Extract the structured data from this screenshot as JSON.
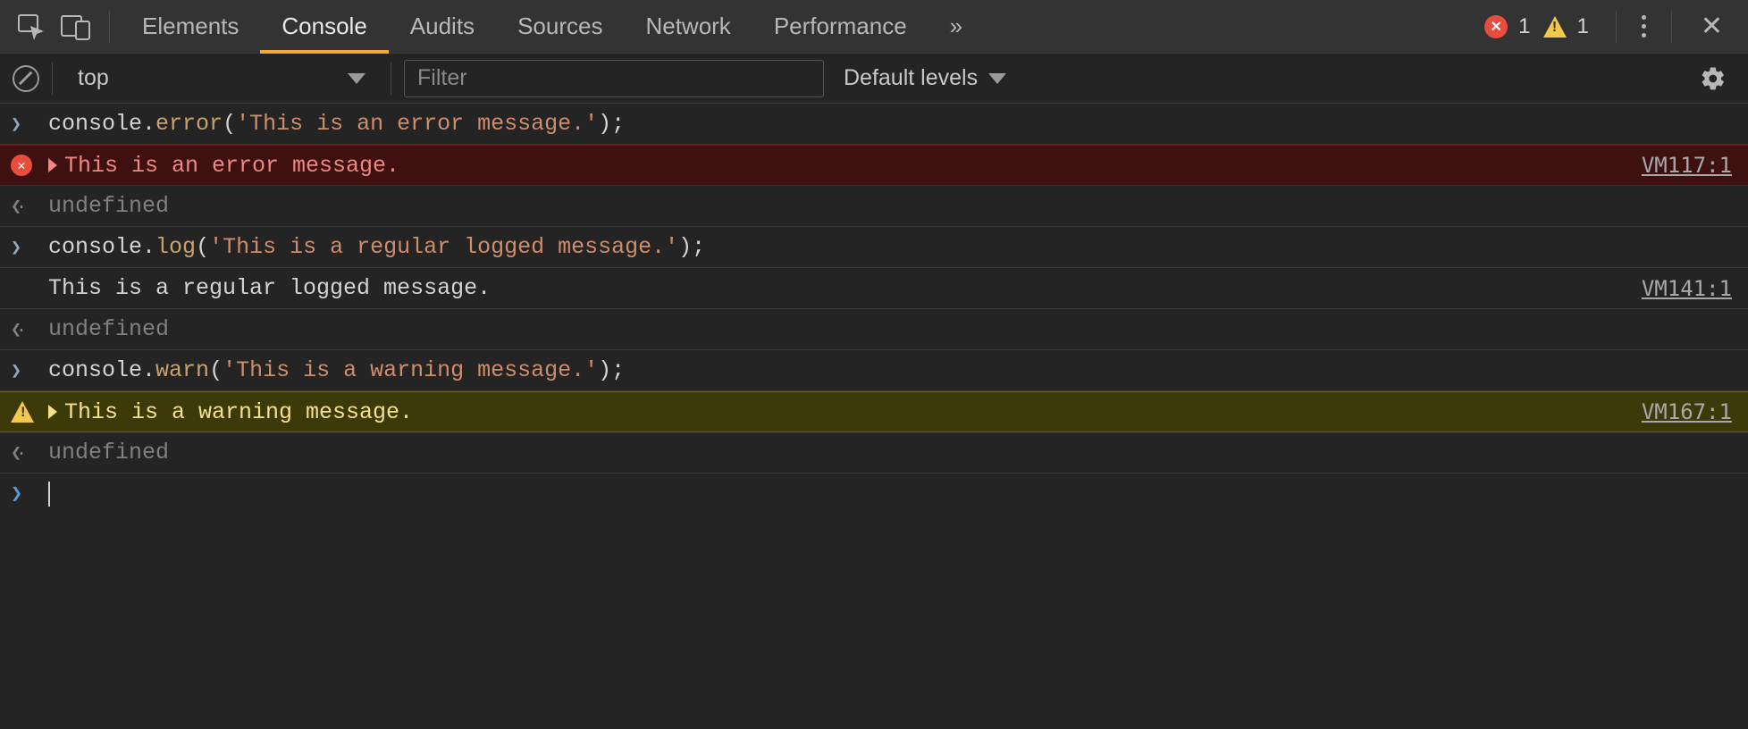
{
  "tabs": {
    "items": [
      "Elements",
      "Console",
      "Audits",
      "Sources",
      "Network",
      "Performance"
    ],
    "active_index": 1,
    "overflow_glyph": "»"
  },
  "status": {
    "error_count": "1",
    "warning_count": "1"
  },
  "toolbar": {
    "context": "top",
    "filter_placeholder": "Filter",
    "levels_label": "Default levels"
  },
  "console": {
    "rows": [
      {
        "kind": "input",
        "code": {
          "obj": "console",
          "dot": ".",
          "method": "error",
          "open": "(",
          "str": "'This is an error message.'",
          "close": ");"
        }
      },
      {
        "kind": "error",
        "text": "This is an error message.",
        "source": "VM117:1"
      },
      {
        "kind": "return",
        "text": "undefined"
      },
      {
        "kind": "input",
        "code": {
          "obj": "console",
          "dot": ".",
          "method": "log",
          "open": "(",
          "str": "'This is a regular logged message.'",
          "close": ");"
        }
      },
      {
        "kind": "log",
        "text": "This is a regular logged message.",
        "source": "VM141:1"
      },
      {
        "kind": "return",
        "text": "undefined"
      },
      {
        "kind": "input",
        "code": {
          "obj": "console",
          "dot": ".",
          "method": "warn",
          "open": "(",
          "str": "'This is a warning message.'",
          "close": ");"
        }
      },
      {
        "kind": "warn",
        "text": "This is a warning message.",
        "source": "VM167:1"
      },
      {
        "kind": "return",
        "text": "undefined"
      }
    ]
  }
}
